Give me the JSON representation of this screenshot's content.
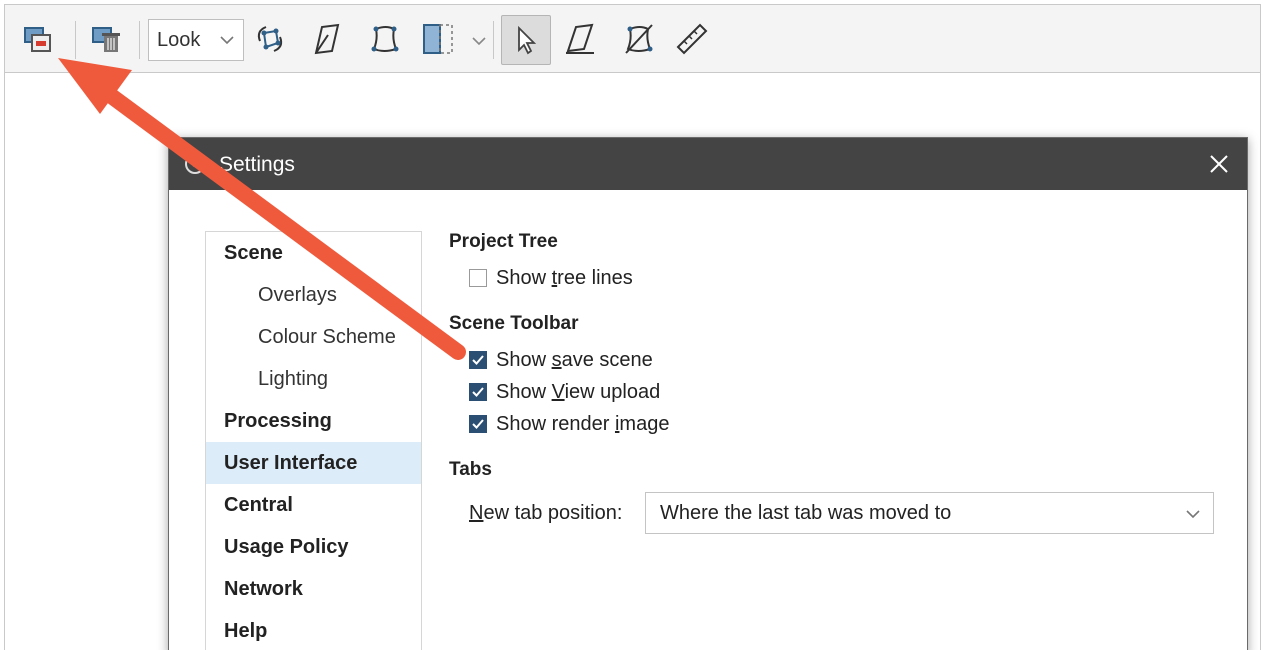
{
  "toolbar": {
    "look_value": "Look",
    "icons": [
      "render-image-icon",
      "delete-scene-icon",
      "rotate-icon",
      "draw-line-icon",
      "polygon-icon",
      "split-view-icon",
      "select-pointer-icon",
      "draw-plane-icon",
      "slice-icon",
      "ruler-icon"
    ]
  },
  "dialog": {
    "title": "Settings",
    "nav": {
      "scene": "Scene",
      "overlays": "Overlays",
      "colour_scheme": "Colour Scheme",
      "lighting": "Lighting",
      "processing": "Processing",
      "user_interface": "User Interface",
      "central": "Central",
      "usage_policy": "Usage Policy",
      "network": "Network",
      "help": "Help"
    },
    "project_tree": {
      "heading": "Project Tree",
      "show_tree_lines_pre": "Show ",
      "show_tree_lines_u": "t",
      "show_tree_lines_post": "ree lines",
      "show_tree_lines_checked": false
    },
    "scene_toolbar": {
      "heading": "Scene Toolbar",
      "save_pre": "Show ",
      "save_u": "s",
      "save_post": "ave scene",
      "save_checked": true,
      "view_pre": "Show ",
      "view_u": "V",
      "view_post": "iew upload",
      "view_checked": true,
      "render_pre": "Show render ",
      "render_u": "i",
      "render_post": "mage",
      "render_checked": true
    },
    "tabs": {
      "heading": "Tabs",
      "label_u": "N",
      "label_post": "ew tab position:",
      "value": "Where the last tab was moved to"
    }
  },
  "colors": {
    "titlebar": "#444444",
    "checkbox": "#2b4f72",
    "nav_selected": "#dcecf8",
    "arrow": "#f05a3c"
  }
}
